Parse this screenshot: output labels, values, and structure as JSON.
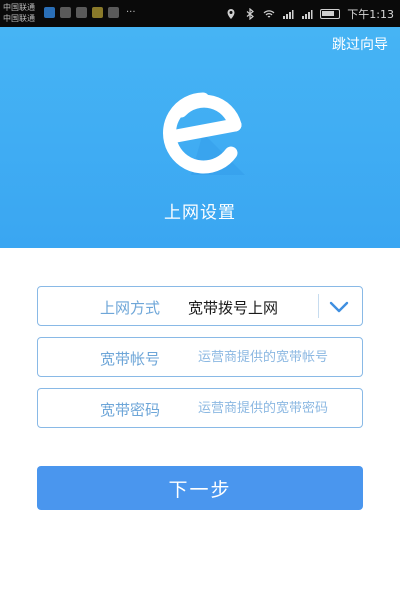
{
  "status_bar": {
    "carrier_line1": "中国联通",
    "carrier_line2": "中国联通",
    "more_indicator": "···",
    "time": "下午1:13"
  },
  "header": {
    "skip_label": "跳过向导",
    "title": "上网设置",
    "logo_icon": "e-logo-icon"
  },
  "form": {
    "connection_type": {
      "label": "上网方式",
      "value": "宽带拨号上网"
    },
    "account": {
      "label": "宽带帐号",
      "placeholder": "运营商提供的宽带帐号"
    },
    "password": {
      "label": "宽带密码",
      "placeholder": "运营商提供的宽带密码"
    }
  },
  "actions": {
    "next_label": "下一步"
  },
  "colors": {
    "accent": "#4a96ee",
    "header_bg": "#3aa6f2",
    "field_border": "#89b9e6",
    "label_text": "#6ea6d8"
  }
}
